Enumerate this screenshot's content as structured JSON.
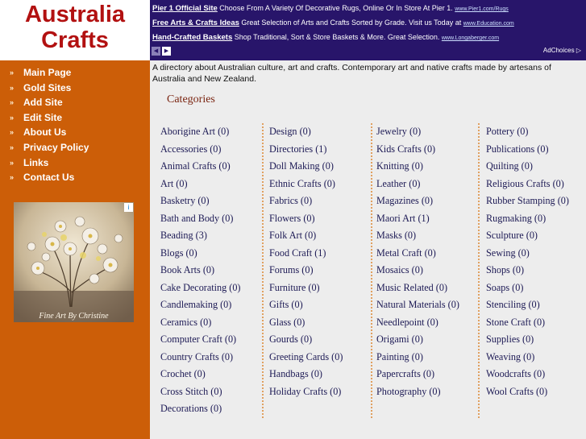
{
  "logo": {
    "line1": "Australia",
    "line2": "Crafts"
  },
  "nav": [
    {
      "bullet": "»",
      "label": "Main Page"
    },
    {
      "bullet": "»",
      "label": "Gold Sites"
    },
    {
      "bullet": "»",
      "label": "Add Site"
    },
    {
      "bullet": "»",
      "label": "Edit Site"
    },
    {
      "bullet": "»",
      "label": "About Us"
    },
    {
      "bullet": "»",
      "label": "Privacy Policy"
    },
    {
      "bullet": "»",
      "label": "Links"
    },
    {
      "bullet": "»",
      "label": "Contact Us"
    }
  ],
  "sidebar_ad": {
    "caption": "Fine Art By Christine",
    "badge": "i"
  },
  "ads": [
    {
      "title": "Pier 1 Official Site",
      "text": " Choose From A Variety Of Decorative Rugs, Online Or In Store At Pier 1. ",
      "url": "www.Pier1.com/Rugs"
    },
    {
      "title": "Free Arts & Crafts Ideas",
      "text": " Great Selection of Arts and Crafts Sorted by Grade. Visit us Today at ",
      "url": "www.Education.com"
    },
    {
      "title": "Hand-Crafted Baskets",
      "text": " Shop Traditional, Sort & Store Baskets & More. Great Selection. ",
      "url": "www.Longaberger.com"
    }
  ],
  "ad_nav": {
    "prev": "◀",
    "next": "▶"
  },
  "adchoices": {
    "label": "AdChoices",
    "icon": "▷"
  },
  "description": "A directory about Australian culture, art and crafts. Contemporary art and native crafts made by artesans of Australia and New Zealand.",
  "categories_heading": "Categories",
  "columns": [
    [
      "Aborigine Art (0)",
      "Accessories (0)",
      "Animal Crafts (0)",
      "Art (0)",
      "Basketry (0)",
      "Bath and Body (0)",
      "Beading (3)",
      "Blogs (0)",
      "Book Arts (0)",
      "Cake Decorating (0)",
      "Candlemaking (0)",
      "Ceramics (0)",
      "Computer Craft (0)",
      "Country Crafts (0)",
      "Crochet (0)",
      "Cross Stitch (0)",
      "Decorations (0)"
    ],
    [
      "Design (0)",
      "Directories (1)",
      "Doll Making (0)",
      "Ethnic Crafts (0)",
      "Fabrics (0)",
      "Flowers (0)",
      "Folk Art (0)",
      "Food Craft (1)",
      "Forums (0)",
      "Furniture (0)",
      "Gifts (0)",
      "Glass (0)",
      "Gourds (0)",
      "Greeting Cards (0)",
      "Handbags (0)",
      "Holiday Crafts (0)"
    ],
    [
      "Jewelry (0)",
      "Kids Crafts (0)",
      "Knitting (0)",
      "Leather (0)",
      "Magazines (0)",
      "Maori Art (1)",
      "Masks (0)",
      "Metal Craft (0)",
      "Mosaics (0)",
      "Music Related (0)",
      "Natural Materials (0)",
      "Needlepoint (0)",
      "Origami (0)",
      "Painting (0)",
      "Papercrafts (0)",
      "Photography (0)"
    ],
    [
      "Pottery (0)",
      "Publications (0)",
      "Quilting (0)",
      "Religious Crafts (0)",
      "Rubber Stamping (0)",
      "Rugmaking (0)",
      "Sculpture (0)",
      "Sewing (0)",
      "Shops (0)",
      "Soaps (0)",
      "Stenciling (0)",
      "Stone Craft (0)",
      "Supplies (0)",
      "Weaving (0)",
      "Woodcrafts (0)",
      "Wool Crafts (0)"
    ]
  ],
  "colors": {
    "sidebar": "#cc5e08",
    "adbar": "#28156a",
    "logo_text": "#b21111",
    "category_link": "#1d1a55",
    "background": "#ededed"
  }
}
